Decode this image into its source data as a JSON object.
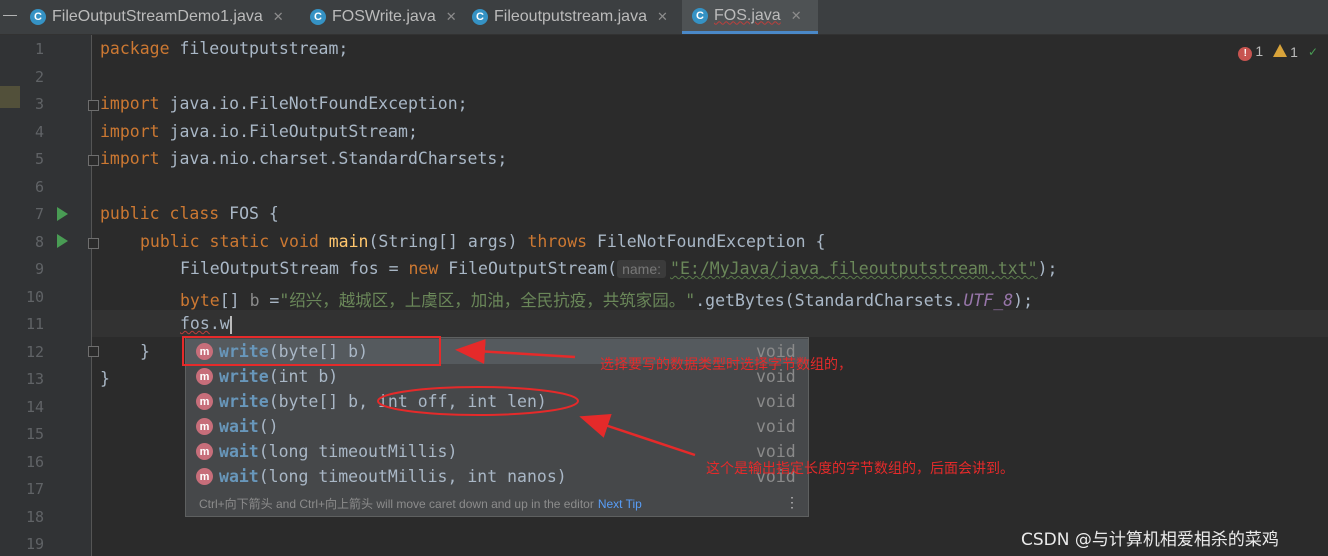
{
  "tabs": [
    {
      "label": "FileOutputStreamDemo1.java",
      "icon": "C",
      "active": false
    },
    {
      "label": "FOSWrite.java",
      "icon": "C",
      "active": false
    },
    {
      "label": "Fileoutputstream.java",
      "icon": "C",
      "active": false
    },
    {
      "label": "FOS.java",
      "icon": "C",
      "active": true
    }
  ],
  "inspections": {
    "errors": "1",
    "warnings": "1"
  },
  "line_numbers": [
    "1",
    "2",
    "3",
    "4",
    "5",
    "6",
    "7",
    "8",
    "9",
    "10",
    "11",
    "12",
    "13",
    "14",
    "15",
    "16",
    "17",
    "18",
    "19"
  ],
  "code": {
    "l1_kw": "package",
    "l1_rest": " fileoutputstream;",
    "l3_kw": "import",
    "l3_rest": " java.io.FileNotFoundException;",
    "l4_kw": "import",
    "l4_rest": " java.io.FileOutputStream;",
    "l5_kw": "import",
    "l5_rest": " java.nio.charset.StandardCharsets;",
    "l7_kw": "public class",
    "l7_rest": " FOS {",
    "l8_kw1": "public static void",
    "l8_fn": "main",
    "l8_a": "(String[] args) ",
    "l8_kw2": "throws",
    "l8_b": " FileNotFoundException {",
    "l9_a": "FileOutputStream fos = ",
    "l9_kw": "new",
    "l9_b": " FileOutputStream(",
    "l9_hint": "name:",
    "l9_str": "\"E:/MyJava/java_fileoutputstream.txt\"",
    "l9_c": ");",
    "l10_kw": "byte",
    "l10_a": "[] ",
    "l10_var": "b",
    "l10_b": " =",
    "l10_str": "\"绍兴，越城区，上虞区，加油，全民抗疫，共筑家园。\"",
    "l10_c": ".getBytes(StandardCharsets.",
    "l10_it": "UTF_8",
    "l10_d": ");",
    "l11_a": "fos",
    "l11_b": ".w",
    "l12": "}",
    "l13": "}"
  },
  "completion": {
    "items": [
      {
        "icon": "m",
        "name_match": "w",
        "name_rest": "rite",
        "params": "(byte[] b)",
        "return": "void"
      },
      {
        "icon": "m",
        "name_match": "w",
        "name_rest": "rite",
        "params": "(int b)",
        "return": "void"
      },
      {
        "icon": "m",
        "name_match": "w",
        "name_rest": "rite",
        "params": "(byte[] b, int off, int len)",
        "return": "void"
      },
      {
        "icon": "m",
        "name_match": "w",
        "name_rest": "ait",
        "params": "()",
        "return": "void"
      },
      {
        "icon": "m",
        "name_match": "w",
        "name_rest": "ait",
        "params": "(long timeoutMillis)",
        "return": "void"
      },
      {
        "icon": "m",
        "name_match": "w",
        "name_rest": "ait",
        "params": "(long timeoutMillis, int nanos)",
        "return": "void"
      }
    ],
    "tip": "Ctrl+向下箭头 and Ctrl+向上箭头 will move caret down and up in the editor",
    "next_tip": "Next Tip"
  },
  "annotations": {
    "first": "选择要写的数据类型时选择字节数组的，",
    "second": "这个是输出指定长度的字节数组的，后面会讲到。"
  },
  "watermark": "CSDN @与计算机相爱相杀的菜鸡",
  "colors": {
    "annotation": "#e52a2a",
    "accent": "#4a88c7",
    "method_icon": "#c76e7a"
  }
}
